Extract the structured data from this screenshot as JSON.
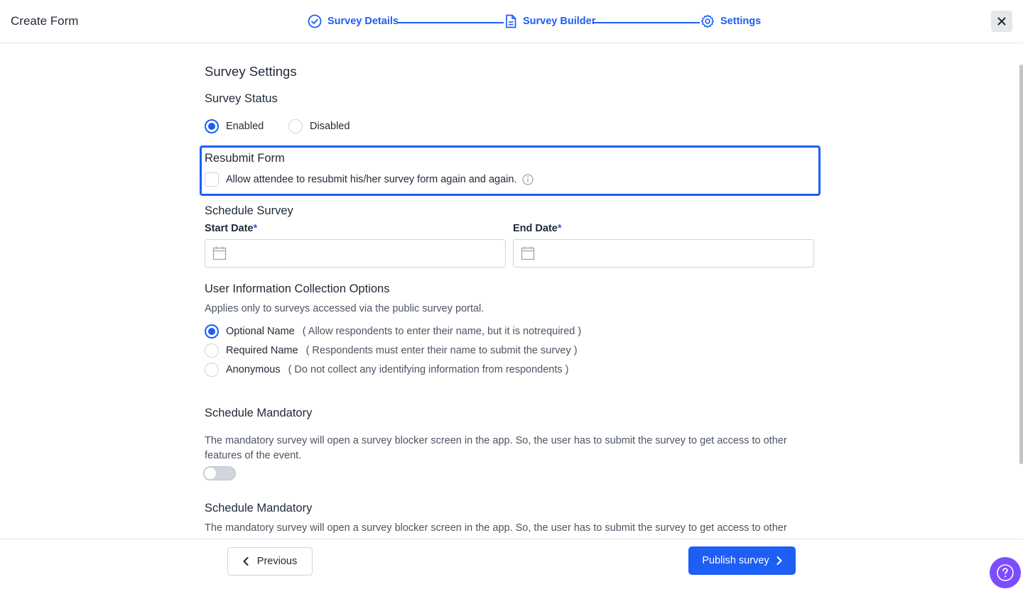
{
  "header": {
    "title": "Create Form",
    "steps": [
      {
        "label": "Survey Details",
        "icon": "check-circle-icon"
      },
      {
        "label": "Survey Builder",
        "icon": "document-icon"
      },
      {
        "label": "Settings",
        "icon": "gear-icon"
      }
    ],
    "close_icon": "close-icon"
  },
  "settings": {
    "heading": "Survey Settings",
    "status": {
      "title": "Survey Status",
      "options": [
        {
          "label": "Enabled",
          "checked": true
        },
        {
          "label": "Disabled",
          "checked": false
        }
      ]
    },
    "resubmit": {
      "title": "Resubmit Form",
      "checkbox_label": "Allow attendee to resubmit his/her survey form again and again.",
      "checked": false
    },
    "schedule": {
      "title": "Schedule Survey",
      "start_label": "Start Date",
      "end_label": "End Date",
      "required_mark": "*",
      "start_value": "",
      "end_value": ""
    },
    "user_info": {
      "title": "User Information Collection Options",
      "helper": "Applies only to surveys accessed via the public survey portal.",
      "options": [
        {
          "label": "Optional Name",
          "desc": "( Allow respondents to enter their name, but it is notrequired )",
          "checked": true
        },
        {
          "label": "Required Name",
          "desc": "( Respondents must enter their name to submit the survey )",
          "checked": false
        },
        {
          "label": "Anonymous",
          "desc": "( Do not collect any identifying information from respondents )",
          "checked": false
        }
      ]
    },
    "mandatory": [
      {
        "title": "Schedule Mandatory",
        "helper": "The mandatory survey will open a survey blocker screen in the app. So, the user has to submit the survey to get access to other features of the event.",
        "toggle_on": false
      },
      {
        "title": "Schedule Mandatory",
        "helper": "The mandatory survey will open a survey blocker screen in the app. So, the user has to submit the survey to get access to other"
      }
    ]
  },
  "footer": {
    "previous_label": "Previous",
    "publish_label": "Publish survey",
    "help_icon": "question-icon"
  },
  "colors": {
    "accent": "#1d5ef5",
    "help_fab": "#7c4dff"
  }
}
